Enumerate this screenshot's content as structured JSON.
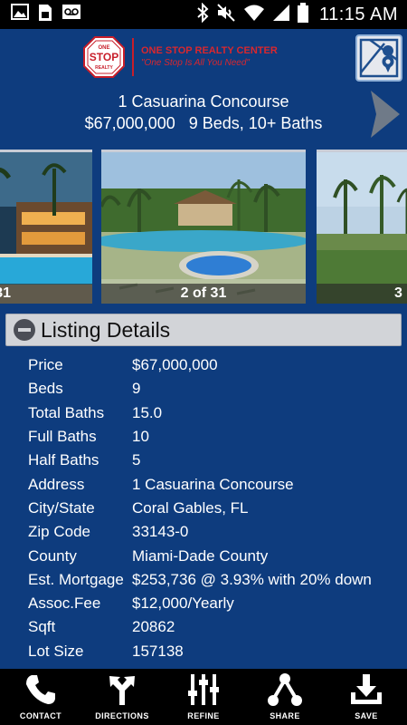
{
  "status_bar": {
    "time": "11:15 AM",
    "left_icons": [
      "image-icon",
      "sim-icon",
      "voicemail-icon"
    ],
    "right_icons": [
      "bluetooth-icon",
      "mute-icon",
      "wifi-icon",
      "signal-icon",
      "battery-icon"
    ]
  },
  "header": {
    "logo_badge_top": "ONE",
    "logo_badge_mid": "STOP",
    "logo_badge_bottom": "REALTY",
    "logo_name": "ONE STOP REALTY CENTER",
    "logo_tagline": "\"One Stop Is All You Need\"",
    "map_icon": "map-pin-icon"
  },
  "listing": {
    "address": "1 Casuarina Concourse",
    "price": "$67,000,000",
    "beds_baths": "9 Beds, 10+ Baths"
  },
  "carousel": {
    "left_caption": "31",
    "center_caption": "2 of 31",
    "right_caption": "3"
  },
  "details": {
    "title": "Listing Details",
    "rows": [
      {
        "label": "Price",
        "value": "$67,000,000"
      },
      {
        "label": "Beds",
        "value": "9"
      },
      {
        "label": "Total Baths",
        "value": "15.0"
      },
      {
        "label": "Full Baths",
        "value": "10"
      },
      {
        "label": "Half Baths",
        "value": "5"
      },
      {
        "label": "Address",
        "value": "1 Casuarina Concourse"
      },
      {
        "label": "City/State",
        "value": "Coral Gables, FL"
      },
      {
        "label": "Zip Code",
        "value": "33143-0"
      },
      {
        "label": "County",
        "value": "Miami-Dade County"
      },
      {
        "label": "Est. Mortgage",
        "value": "$253,736 @ 3.93% with 20% down"
      },
      {
        "label": "Assoc.Fee",
        "value": "$12,000/Yearly"
      },
      {
        "label": "Sqft",
        "value": "20862"
      },
      {
        "label": "Lot Size",
        "value": "157138"
      }
    ]
  },
  "nav": {
    "items": [
      {
        "label": "CONTACT",
        "icon": "phone-icon"
      },
      {
        "label": "DIRECTIONS",
        "icon": "directions-icon"
      },
      {
        "label": "REFINE",
        "icon": "sliders-icon"
      },
      {
        "label": "SHARE",
        "icon": "share-icon"
      },
      {
        "label": "SAVE",
        "icon": "download-icon"
      }
    ]
  },
  "colors": {
    "background": "#0e3c7e",
    "brand_red": "#d9272e",
    "section_bar": "#d2d4d8",
    "nav_bar": "#000000"
  }
}
